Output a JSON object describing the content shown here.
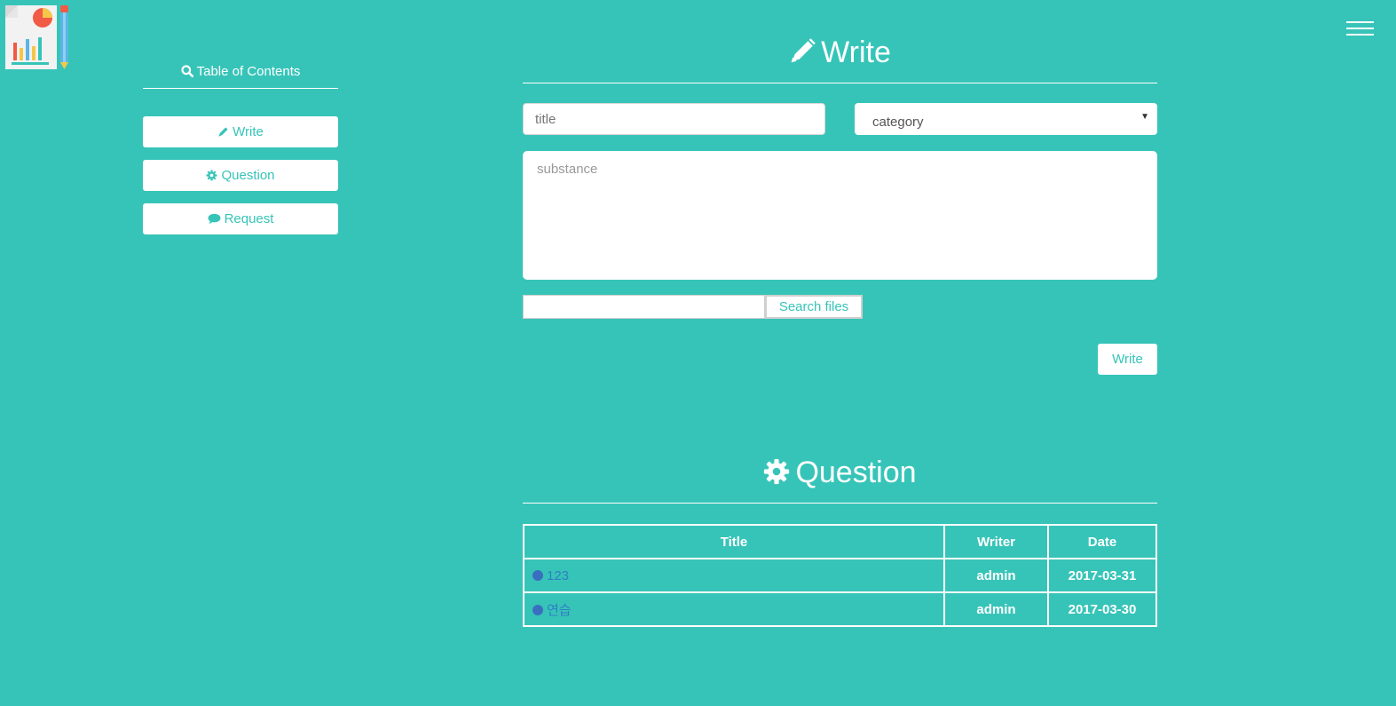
{
  "sidebar": {
    "toc_title": "Table of Contents",
    "items": [
      {
        "label": "Write",
        "icon": "pencil-icon"
      },
      {
        "label": "Question",
        "icon": "gear-icon"
      },
      {
        "label": "Request",
        "icon": "comment-icon"
      }
    ]
  },
  "write": {
    "heading": "Write",
    "title_placeholder": "title",
    "category_value": "category",
    "substance_placeholder": "substance",
    "file_button": "Search files",
    "submit_label": "Write"
  },
  "question": {
    "heading": "Question",
    "columns": [
      "Title",
      "Writer",
      "Date"
    ],
    "rows": [
      {
        "title": "123",
        "writer": "admin",
        "date": "2017-03-31"
      },
      {
        "title": "연습",
        "writer": "admin",
        "date": "2017-03-30"
      }
    ]
  },
  "colors": {
    "background": "#37c4b8",
    "accent_text": "#37c4b8",
    "link": "#2f7fc4",
    "dot": "#3a6fc0"
  }
}
